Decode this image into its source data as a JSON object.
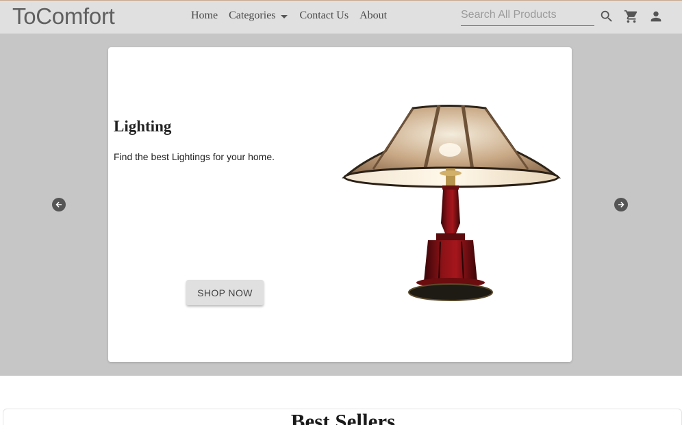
{
  "header": {
    "logo": "ToComfort",
    "nav": {
      "home": "Home",
      "categories": "Categories",
      "contact": "Contact Us",
      "about": "About"
    },
    "search": {
      "placeholder": "Search All Products",
      "value": ""
    },
    "icons": [
      "search-icon",
      "cart-icon",
      "account-icon"
    ]
  },
  "carousel": {
    "slide": {
      "title": "Lighting",
      "description": "Find the best Lightings for your home.",
      "button_label": "SHOP NOW",
      "image": "table-lamp"
    },
    "prev_icon": "arrow-left-icon",
    "next_icon": "arrow-right-icon"
  },
  "sections": {
    "best_sellers_title": "Best Sellers"
  },
  "colors": {
    "header_bg": "#e0e0e0",
    "hero_bg": "#c6c6c6",
    "card_bg": "#ffffff",
    "button_bg": "#e0e0e0",
    "arrow_bg": "#555555"
  }
}
